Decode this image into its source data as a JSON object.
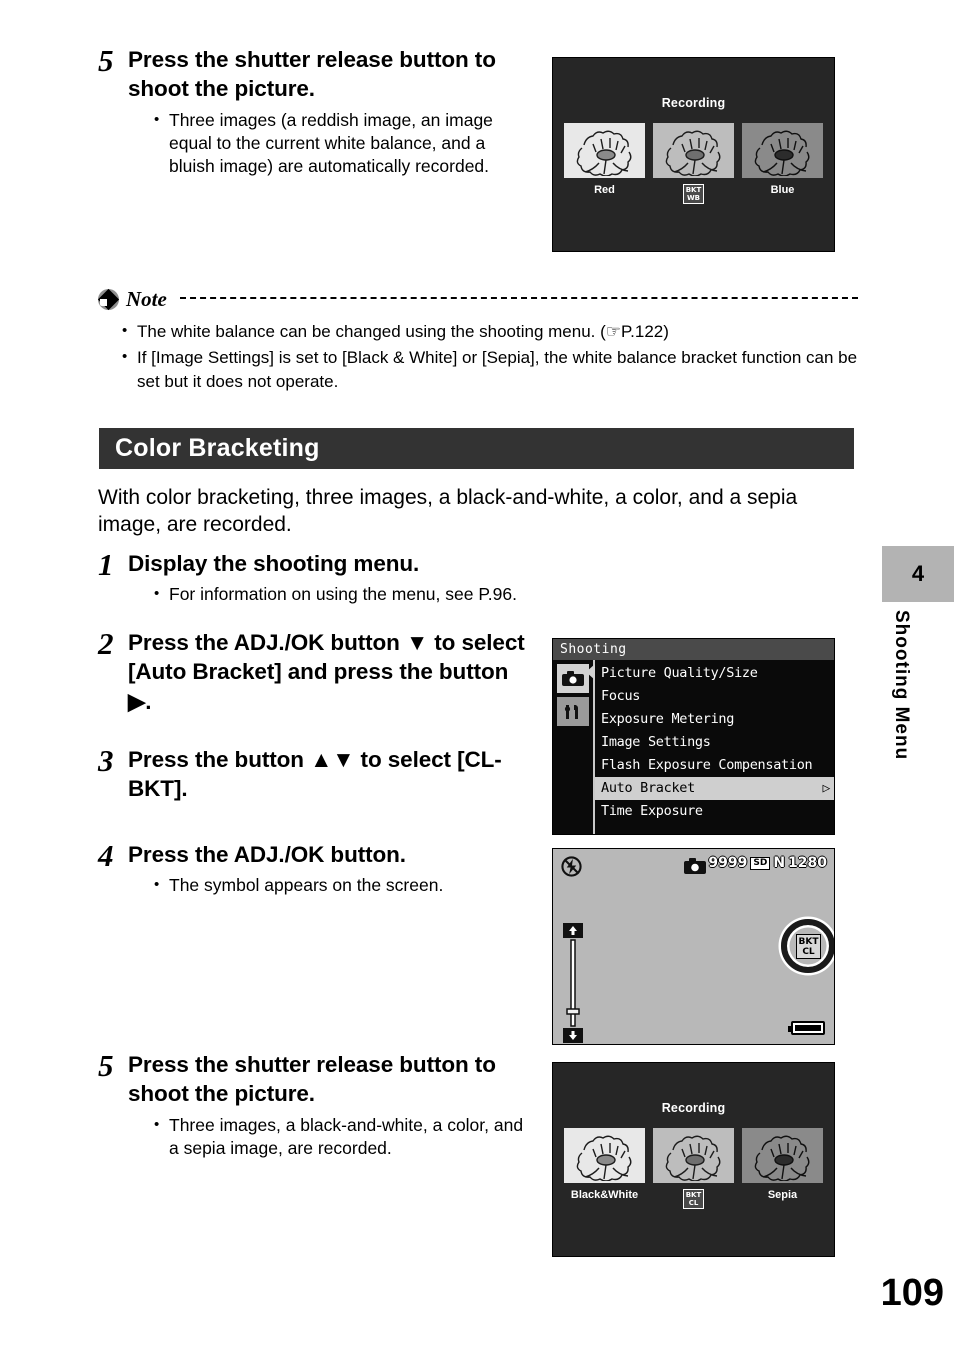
{
  "page": {
    "number": "109",
    "side_tab": {
      "chapter": "4",
      "label": "Shooting Menu"
    }
  },
  "step_wb_5": {
    "number": "5",
    "title": "Press the shutter release button to shoot the picture.",
    "bullets": [
      "Three images (a reddish image, an image equal to the current white balance, and a bluish image) are automatically recorded."
    ]
  },
  "wb_recording_screen": {
    "title": "Recording",
    "labels": [
      "Red",
      "Blue"
    ],
    "badge_top": "BKT",
    "badge_bottom": "WB"
  },
  "note": {
    "label": "Note",
    "bullets": [
      "The white balance can be changed using the shooting menu. (☞P.122)",
      "If [Image Settings] is set to [Black & White] or [Sepia], the white balance bracket function can be set but it does not operate."
    ]
  },
  "section": {
    "heading": "Color Bracketing",
    "intro": "With color bracketing, three images, a black-and-white, a color, and a sepia image, are recorded."
  },
  "steps": [
    {
      "number": "1",
      "title": "Display the shooting menu.",
      "bullets": [
        "For information on using the menu, see P.96."
      ]
    },
    {
      "number": "2",
      "title": "Press the ADJ./OK button ▼ to select [Auto Bracket] and press the button ▶.",
      "bullets": []
    },
    {
      "number": "3",
      "title": "Press the button ▲▼ to select [CL-BKT].",
      "bullets": []
    },
    {
      "number": "4",
      "title": "Press the ADJ./OK button.",
      "bullets": [
        "The symbol appears on the screen."
      ]
    },
    {
      "number": "5",
      "title": "Press the shutter release button to shoot the picture.",
      "bullets": [
        "Three images, a black-and-white, a color, and a sepia image, are recorded."
      ]
    }
  ],
  "shooting_menu": {
    "header": "Shooting",
    "items": [
      "Picture Quality/Size",
      "Focus",
      "Exposure Metering",
      "Image Settings",
      "Flash Exposure Compensation",
      "Auto Bracket",
      "Time Exposure"
    ],
    "selected_item": "Auto Bracket",
    "selected_arrow": "▷",
    "tab_icons": [
      "camera-icon",
      "setup-icon"
    ]
  },
  "lcd_screen": {
    "shots_remaining": "9999",
    "media": "SD",
    "quality": "N",
    "image_size": "1280",
    "bkt_badge_top": "BKT",
    "bkt_badge_bottom": "CL"
  },
  "cl_recording_screen": {
    "title": "Recording",
    "labels": [
      "Black&White",
      "Sepia"
    ],
    "badge_top": "BKT",
    "badge_bottom": "CL"
  }
}
